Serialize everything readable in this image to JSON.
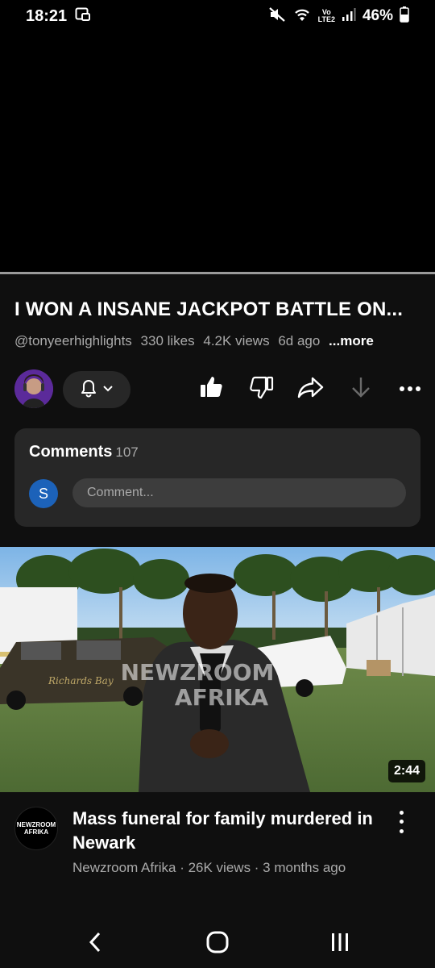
{
  "status_bar": {
    "time": "18:21",
    "volte_top": "Vo",
    "volte_bottom": "LTE2",
    "battery": "46%"
  },
  "video": {
    "title": "I WON A INSANE JACKPOT BATTLE ON...",
    "channel_handle": "@tonyeerhighlights",
    "likes": "330 likes",
    "views": "4.2K views",
    "age": "6d ago",
    "more": "...more"
  },
  "actions": {
    "icons": [
      "bell-icon",
      "chevron-down-icon",
      "like-icon",
      "dislike-icon",
      "share-icon",
      "download-icon",
      "more-icon"
    ]
  },
  "comments": {
    "label": "Comments",
    "count": "107",
    "user_initial": "S",
    "placeholder": "Comment..."
  },
  "recommended": {
    "duration": "2:44",
    "title": "Mass funeral for family murdered in Newark",
    "channel": "Newzroom Afrika",
    "views": "26K views",
    "age": "3 months ago",
    "meta": "Newzroom Afrika · 26K views · 3 months ago",
    "avatar_text": "NEWZROOM AFRIKA",
    "watermark_top": "NEWZROOM",
    "watermark_bottom": "AFRIKA",
    "van_text": "Richards Bay"
  },
  "colors": {
    "background": "#0f0f0f",
    "card": "#272727",
    "secondary_text": "#aaaaaa",
    "user_avatar": "#1c62b9"
  }
}
